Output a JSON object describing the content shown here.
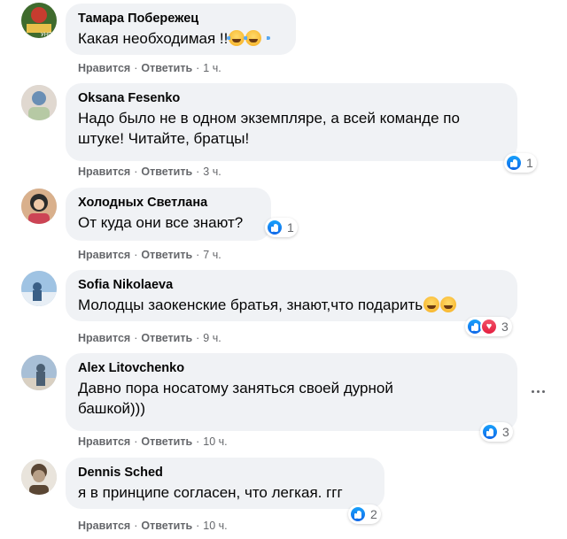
{
  "actions": {
    "like": "Нравится",
    "reply": "Ответить",
    "separator": "·"
  },
  "comments": [
    {
      "author": "Тамара Побережец",
      "lines": [
        "Какая необходимая !!"
      ],
      "emoji": [
        "face-with-tears-of-joy",
        "face-with-tears-of-joy"
      ],
      "time": "1 ч.",
      "avatar_colors": [
        "#c73c2f",
        "#3f6b2d",
        "#e8c04a"
      ]
    },
    {
      "author": "Oksana Fesenko",
      "lines": [
        "Надо было не в одном экземпляре, а всей команде по",
        "штуке! Читайте, братцы!"
      ],
      "time": "3 ч.",
      "reactions": {
        "icons": [
          "like"
        ],
        "count": "1"
      },
      "avatar_colors": [
        "#6a8fb5",
        "#b6c9a4",
        "#e0d8d0"
      ]
    },
    {
      "author": "Холодных Светлана",
      "lines": [
        "От куда они все знают?"
      ],
      "time": "7 ч.",
      "reactions": {
        "icons": [
          "like"
        ],
        "count": "1"
      },
      "avatar_colors": [
        "#2b2b2b",
        "#cc4455",
        "#d9b08c"
      ]
    },
    {
      "author": "Sofia Nikolaeva",
      "lines": [
        "Молодцы заокенские братья, знают,что подарить"
      ],
      "emoji": [
        "relieved-face",
        "grinning-face"
      ],
      "time": "9 ч.",
      "reactions": {
        "icons": [
          "like",
          "love"
        ],
        "count": "3"
      },
      "avatar_colors": [
        "#9fc3e3",
        "#3a5f86",
        "#e7eef5"
      ]
    },
    {
      "author": "Alex Litovchenko",
      "lines": [
        "Давно пора носатому заняться своей дурной",
        "башкой)))"
      ],
      "time": "10 ч.",
      "reactions": {
        "icons": [
          "like"
        ],
        "count": "3"
      },
      "avatar_colors": [
        "#a8bfd6",
        "#4b5f73",
        "#d9d0c2"
      ]
    },
    {
      "author": "Dennis Sched",
      "lines": [
        "я в принципе согласен, что легкая. ггг"
      ],
      "time": "10 ч.",
      "reactions": {
        "icons": [
          "like"
        ],
        "count": "2"
      },
      "avatar_colors": [
        "#e9e4dc",
        "#5a4634",
        "#b8a088"
      ]
    }
  ],
  "more_icon": "more-horizontal-icon",
  "colors": {
    "bubble": "#f0f2f5",
    "meta": "#65676b",
    "like_blue": "#1877f2",
    "love_red": "#e41e3f"
  }
}
